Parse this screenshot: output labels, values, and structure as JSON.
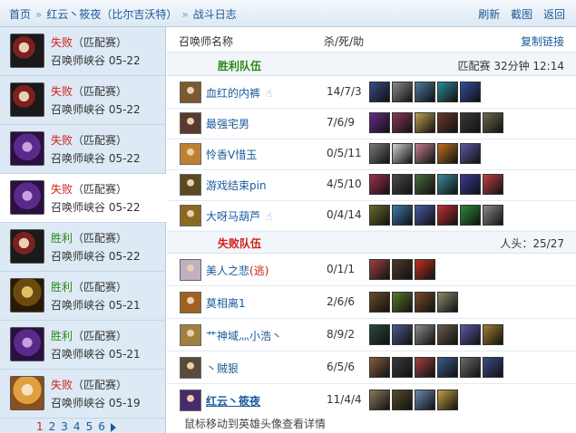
{
  "breadcrumb": {
    "home": "首页",
    "player": "红云丶筱夜（比尔吉沃特）",
    "page": "战斗日志"
  },
  "actions": {
    "refresh": "刷新",
    "screenshot": "截图",
    "back": "返回"
  },
  "table": {
    "col_name": "召唤师名称",
    "col_kda": "杀/死/助",
    "copy_link": "复制链接"
  },
  "teams": {
    "win": {
      "label": "胜利队伍",
      "meta": "匹配赛 32分钟 12:14"
    },
    "lose": {
      "label": "失败队伍",
      "meta": "人头：25/27"
    }
  },
  "players_win": [
    {
      "name": "血红的内裤",
      "kda": "14/7/3",
      "champ": "#7a5a30",
      "hand": true,
      "items": [
        "#3a4a8a",
        "#8a8a8a",
        "#4a7aa0",
        "#2a8a9a",
        "#3050a0"
      ]
    },
    {
      "name": "最强宅男",
      "kda": "7/6/9",
      "champ": "#5a3a30",
      "hand": false,
      "items": [
        "#6a2a8a",
        "#8a3a5a",
        "#c0a050",
        "#6a3a2a",
        "#3a3a3a",
        "#6a6a4a"
      ]
    },
    {
      "name": "怜香V惜玉",
      "kda": "0/5/11",
      "champ": "#c08030",
      "hand": false,
      "items": [
        "#7a7a7a",
        "#d0d0d0",
        "#c08090",
        "#c07020",
        "#5a5aa0"
      ]
    },
    {
      "name": "游戏结束pin",
      "kda": "4/5/10",
      "champ": "#5a4a20",
      "hand": false,
      "items": [
        "#a03050",
        "#4a4a4a",
        "#4a6a3a",
        "#3a8a9a",
        "#3a3a9a",
        "#c04040"
      ]
    },
    {
      "name": "大呀马葫芦",
      "kda": "0/4/14",
      "champ": "#8a6a20",
      "hand": true,
      "items": [
        "#6a6a2a",
        "#3a7aaa",
        "#4a5aa0",
        "#c03030",
        "#2a8a3a",
        "#8a8a8a"
      ]
    }
  ],
  "players_lose": [
    {
      "name": "美人之悲",
      "flee": "(逃)",
      "kda": "0/1/1",
      "champ": "#c0b0c0",
      "items": [
        "#a04040",
        "#4a3a2a",
        "#c03020"
      ],
      "self": false
    },
    {
      "name": "莫相离1",
      "kda": "2/6/6",
      "champ": "#a06020",
      "items": [
        "#6a4a2a",
        "#5a7a2a",
        "#7a4a2a",
        "#8a8a6a"
      ],
      "self": false
    },
    {
      "name": "艹神域灬小浩丶",
      "kda": "8/9/2",
      "champ": "#a08040",
      "items": [
        "#2a4a3a",
        "#4a5a8a",
        "#8a8a8a",
        "#6a5a4a",
        "#5a5aaa",
        "#a08030"
      ],
      "self": false
    },
    {
      "name": "丶贼狠",
      "kda": "6/5/6",
      "champ": "#5a4a3a",
      "items": [
        "#8a5a3a",
        "#3a3a3a",
        "#a04040",
        "#3a5a8a",
        "#6a6a6a",
        "#3a4a8a"
      ],
      "self": false
    },
    {
      "name": "红云丶筱夜",
      "kda": "11/4/4",
      "champ": "#4a2a6a",
      "items": [
        "#8a7a5a",
        "#5a4a2a",
        "#6a8ab0",
        "#c0a040"
      ],
      "self": true
    }
  ],
  "matches": [
    {
      "result": "失败",
      "type": "（匹配赛）",
      "map": "召唤师峡谷",
      "date": "05-22",
      "avatar": "a1",
      "win": false
    },
    {
      "result": "失败",
      "type": "（匹配赛）",
      "map": "召唤师峡谷",
      "date": "05-22",
      "avatar": "a1",
      "win": false
    },
    {
      "result": "失败",
      "type": "（匹配赛）",
      "map": "召唤师峡谷",
      "date": "05-22",
      "avatar": "a2",
      "win": false
    },
    {
      "result": "失败",
      "type": "（匹配赛）",
      "map": "召唤师峡谷",
      "date": "05-22",
      "avatar": "a2",
      "win": false
    },
    {
      "result": "胜利",
      "type": "（匹配赛）",
      "map": "召唤师峡谷",
      "date": "05-22",
      "avatar": "a1",
      "win": true
    },
    {
      "result": "胜利",
      "type": "（匹配赛）",
      "map": "召唤师峡谷",
      "date": "05-21",
      "avatar": "a3",
      "win": true
    },
    {
      "result": "胜利",
      "type": "（匹配赛）",
      "map": "召唤师峡谷",
      "date": "05-21",
      "avatar": "a2",
      "win": true
    },
    {
      "result": "失败",
      "type": "（匹配赛）",
      "map": "召唤师峡谷",
      "date": "05-19",
      "avatar": "a4",
      "win": false
    }
  ],
  "active_match_index": 3,
  "pager": {
    "pages": [
      "1",
      "2",
      "3",
      "4",
      "5",
      "6"
    ],
    "current": "1"
  },
  "footer_tip": "鼠标移动到英雄头像查看详情"
}
